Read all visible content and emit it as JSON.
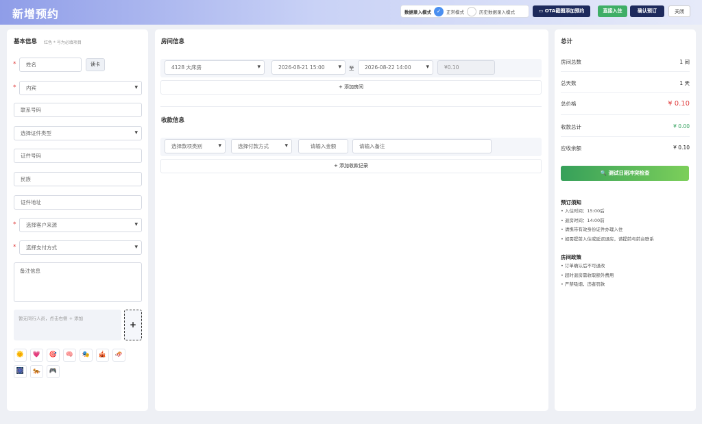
{
  "header": {
    "title": "新增预约",
    "mode_label": "数据录入模式",
    "mode_options": [
      "正常模式",
      "历史数据录入模式"
    ],
    "mode_check": "✓",
    "buttons": {
      "ota": "OTA截图添加预约",
      "checkin": "直接入住",
      "confirm": "确认预订",
      "close": "关闭"
    }
  },
  "basic_info": {
    "title": "基本信息",
    "hint": "红色 * 号为必填项目",
    "required_mark": "*",
    "name_placeholder": "姓名",
    "read_card": "读卡",
    "guest_type": "内宾",
    "phone_placeholder": "联系号码",
    "id_type": "选择证件类型",
    "id_number_placeholder": "证件号码",
    "ethnicity_placeholder": "民族",
    "address_placeholder": "证件地址",
    "source": "选择客户来源",
    "payment_method": "选择支付方式",
    "remark_placeholder": "备注信息",
    "companion_hint": "暂无同行人员，点击右侧 + 添加",
    "add_companion": "+",
    "emoji_tags": [
      "🌞",
      "💗",
      "🎯",
      "🧠",
      "🎭",
      "🎪",
      "🛷",
      "🎆",
      "🐅",
      "🎮"
    ]
  },
  "room_info": {
    "title": "房间信息",
    "room": "4128 大床房",
    "checkin_time": "2026-08-21 15:00",
    "to_label": "至",
    "checkout_time": "2026-08-22 14:00",
    "price": "¥0.10",
    "add_room": "+ 添加房间"
  },
  "payment_info": {
    "title": "收款信息",
    "category": "选择款项类别",
    "method": "选择付款方式",
    "amount_placeholder": "请输入金额",
    "remark_placeholder": "请输入备注",
    "add_record": "+ 添加收款记录"
  },
  "summary": {
    "title": "总计",
    "rows": [
      {
        "label": "房间总数",
        "value": "1 间"
      },
      {
        "label": "总天数",
        "value": "1 天"
      },
      {
        "label": "总价格",
        "value": "¥ 0.10"
      },
      {
        "label": "收款总计",
        "value": "¥ 0.00"
      },
      {
        "label": "应收余额",
        "value": "¥ 0.10"
      }
    ],
    "check_button": "测试日期冲突检查",
    "notice_title": "预订须知",
    "notice_items": [
      "• 入住时间：15:00后",
      "• 退房时间：14:00前",
      "• 请携带有效身份证件办理入住",
      "• 如需提前入住或延迟退房，请提前与前台联系"
    ],
    "policy_title": "房间政策",
    "policy_items": [
      "• 订单确认后不可退改",
      "• 超时退房需收取额外费用",
      "• 严禁吸烟，违者罚款"
    ]
  },
  "colors": {
    "primary": "#1d2a5c",
    "success": "#3fae66",
    "danger": "#e03a3a",
    "accent": "#4a8ff0"
  }
}
